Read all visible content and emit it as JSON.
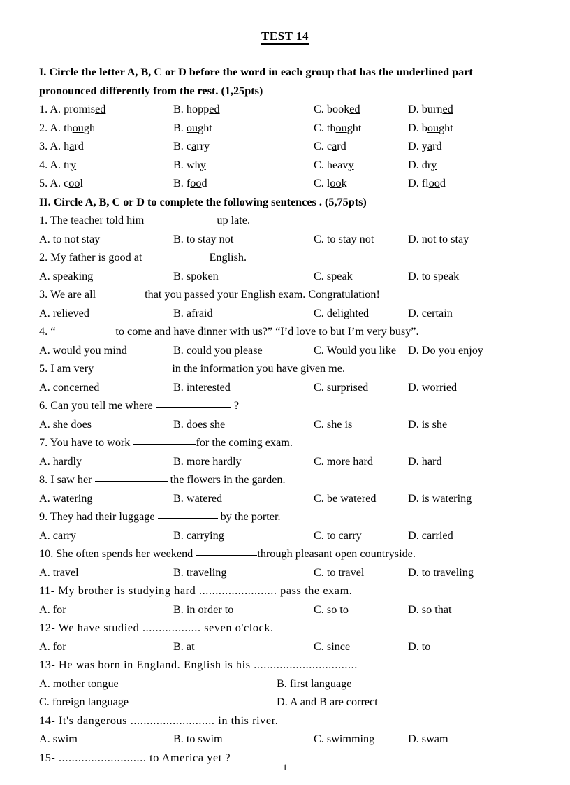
{
  "document": {
    "title": "TEST 14",
    "page_number": "1"
  },
  "section_1": {
    "heading": "I. Circle the letter A, B, C or D before the word in each group that has the underlined part pronounced differently from the rest. (1,25pts)",
    "questions": [
      {
        "number": "1.",
        "options": [
          {
            "label": "A.",
            "pre": "promis",
            "mark": "ed",
            "post": ""
          },
          {
            "label": "B.",
            "pre": "hopp",
            "mark": "ed",
            "post": ""
          },
          {
            "label": "C.",
            "pre": "book",
            "mark": "ed",
            "post": ""
          },
          {
            "label": "D.",
            "pre": "burn",
            "mark": "ed",
            "post": ""
          }
        ]
      },
      {
        "number": "2.",
        "options": [
          {
            "label": "A.",
            "pre": "th",
            "mark": "ou",
            "post": "gh"
          },
          {
            "label": "B.",
            "pre": "",
            "mark": "ou",
            "post": "ght"
          },
          {
            "label": "C.",
            "pre": "th",
            "mark": "ou",
            "post": "ght"
          },
          {
            "label": "D.",
            "pre": "b",
            "mark": "ou",
            "post": "ght"
          }
        ]
      },
      {
        "number": "3.",
        "options": [
          {
            "label": "A.",
            "pre": "h",
            "mark": "a",
            "post": "rd"
          },
          {
            "label": "B.",
            "pre": "c",
            "mark": "a",
            "post": "rry"
          },
          {
            "label": "C.",
            "pre": "c",
            "mark": "a",
            "post": "rd"
          },
          {
            "label": "D.",
            "pre": "y",
            "mark": "a",
            "post": "rd"
          }
        ]
      },
      {
        "number": "4.",
        "options": [
          {
            "label": "A.",
            "pre": "tr",
            "mark": "y",
            "post": ""
          },
          {
            "label": "B.",
            "pre": "wh",
            "mark": "y",
            "post": ""
          },
          {
            "label": "C.",
            "pre": "heav",
            "mark": "y",
            "post": ""
          },
          {
            "label": "D.",
            "pre": "dr",
            "mark": "y",
            "post": ""
          }
        ]
      },
      {
        "number": "5.",
        "options": [
          {
            "label": "A.",
            "pre": "c",
            "mark": "oo",
            "post": "l"
          },
          {
            "label": "B.",
            "pre": "f",
            "mark": "oo",
            "post": "d"
          },
          {
            "label": "C.",
            "pre": "l",
            "mark": "oo",
            "post": "k"
          },
          {
            "label": "D.",
            "pre": "fl",
            "mark": "oo",
            "post": "d"
          }
        ]
      }
    ]
  },
  "section_2": {
    "heading": "II. Circle A, B, C or D to complete the following sentences . (5,75pts)",
    "questions": [
      {
        "number": "1.",
        "stem_before": "1. The teacher told him ",
        "stem_after": " up late.",
        "options": [
          "A. to not stay",
          "B. to stay not",
          "C. to stay not",
          "D. not to stay"
        ]
      },
      {
        "number": "2.",
        "stem_before": "2. My father is good at ",
        "stem_after": "English.",
        "options": [
          "A. speaking",
          "B. spoken",
          "C. speak",
          "D. to speak"
        ]
      },
      {
        "number": "3.",
        "stem_before": "3. We are all ",
        "stem_after": "that you passed your English  exam. Congratulation!",
        "options": [
          "A. relieved",
          "B. afraid",
          "C. delighted",
          "D. certain"
        ]
      },
      {
        "number": "4.",
        "stem_before": "4. “",
        "stem_after": "to come and have dinner with us?” “I’d love to but I’m very busy”.",
        "options": [
          "A. would you mind",
          "B. could you please",
          "C. Would you like",
          "D. Do you enjoy"
        ]
      },
      {
        "number": "5.",
        "stem_before": "5. I am very ",
        "stem_after": " in the information you have given me.",
        "options": [
          "A. concerned",
          "B. interested",
          "C. surprised",
          "D. worried"
        ]
      },
      {
        "number": "6.",
        "stem_before": "6. Can you tell  me where ",
        "stem_after": " ?",
        "options": [
          "A. she does",
          "B. does she",
          "C. she is",
          "D. is she"
        ]
      },
      {
        "number": "7.",
        "stem_before": "7. You have to work ",
        "stem_after": "for the coming exam.",
        "options": [
          "A. hardly",
          "B. more hardly",
          "C. more hard",
          "D. hard"
        ]
      },
      {
        "number": "8.",
        "stem_before": "8. I saw her ",
        "stem_after": " the flowers in the garden.",
        "options": [
          "A. watering",
          "B. watered",
          "C. be watered",
          "D. is watering"
        ]
      },
      {
        "number": "9.",
        "stem_before": "9. They had their luggage ",
        "stem_after": " by the porter.",
        "options": [
          "A. carry",
          "B. carrying",
          "C. to carry",
          "D. carried"
        ]
      },
      {
        "number": "10.",
        "stem_before": "10. She often spends her weekend ",
        "stem_after": "through pleasant open countryside.",
        "options": [
          "A. travel",
          "B. traveling",
          "C. to travel",
          "D. to traveling"
        ]
      },
      {
        "number": "11-",
        "stem_full": "11- My brother is studying hard ........................ pass the exam.",
        "options": [
          "A. for",
          "B. in order to",
          "C. so to",
          "D. so that"
        ]
      },
      {
        "number": "12-",
        "stem_full": "12- We have studied .................. seven o'clock.",
        "options": [
          "A. for",
          "B. at",
          "C. since",
          "D. to"
        ]
      },
      {
        "number": "13-",
        "stem_full": "13- He was born in England. English  is his ................................",
        "options_2col": [
          "A. mother tongue",
          "B. first language",
          "C. foreign language",
          "D. A and B  are correct"
        ]
      },
      {
        "number": "14-",
        "stem_full": "14- It's dangerous .......................... in this river.",
        "options": [
          "A. swim",
          "B. to swim",
          "C. swimming",
          "D. swam"
        ]
      },
      {
        "number": "15-",
        "stem_full": "15- ........................... to America yet ?"
      }
    ]
  }
}
